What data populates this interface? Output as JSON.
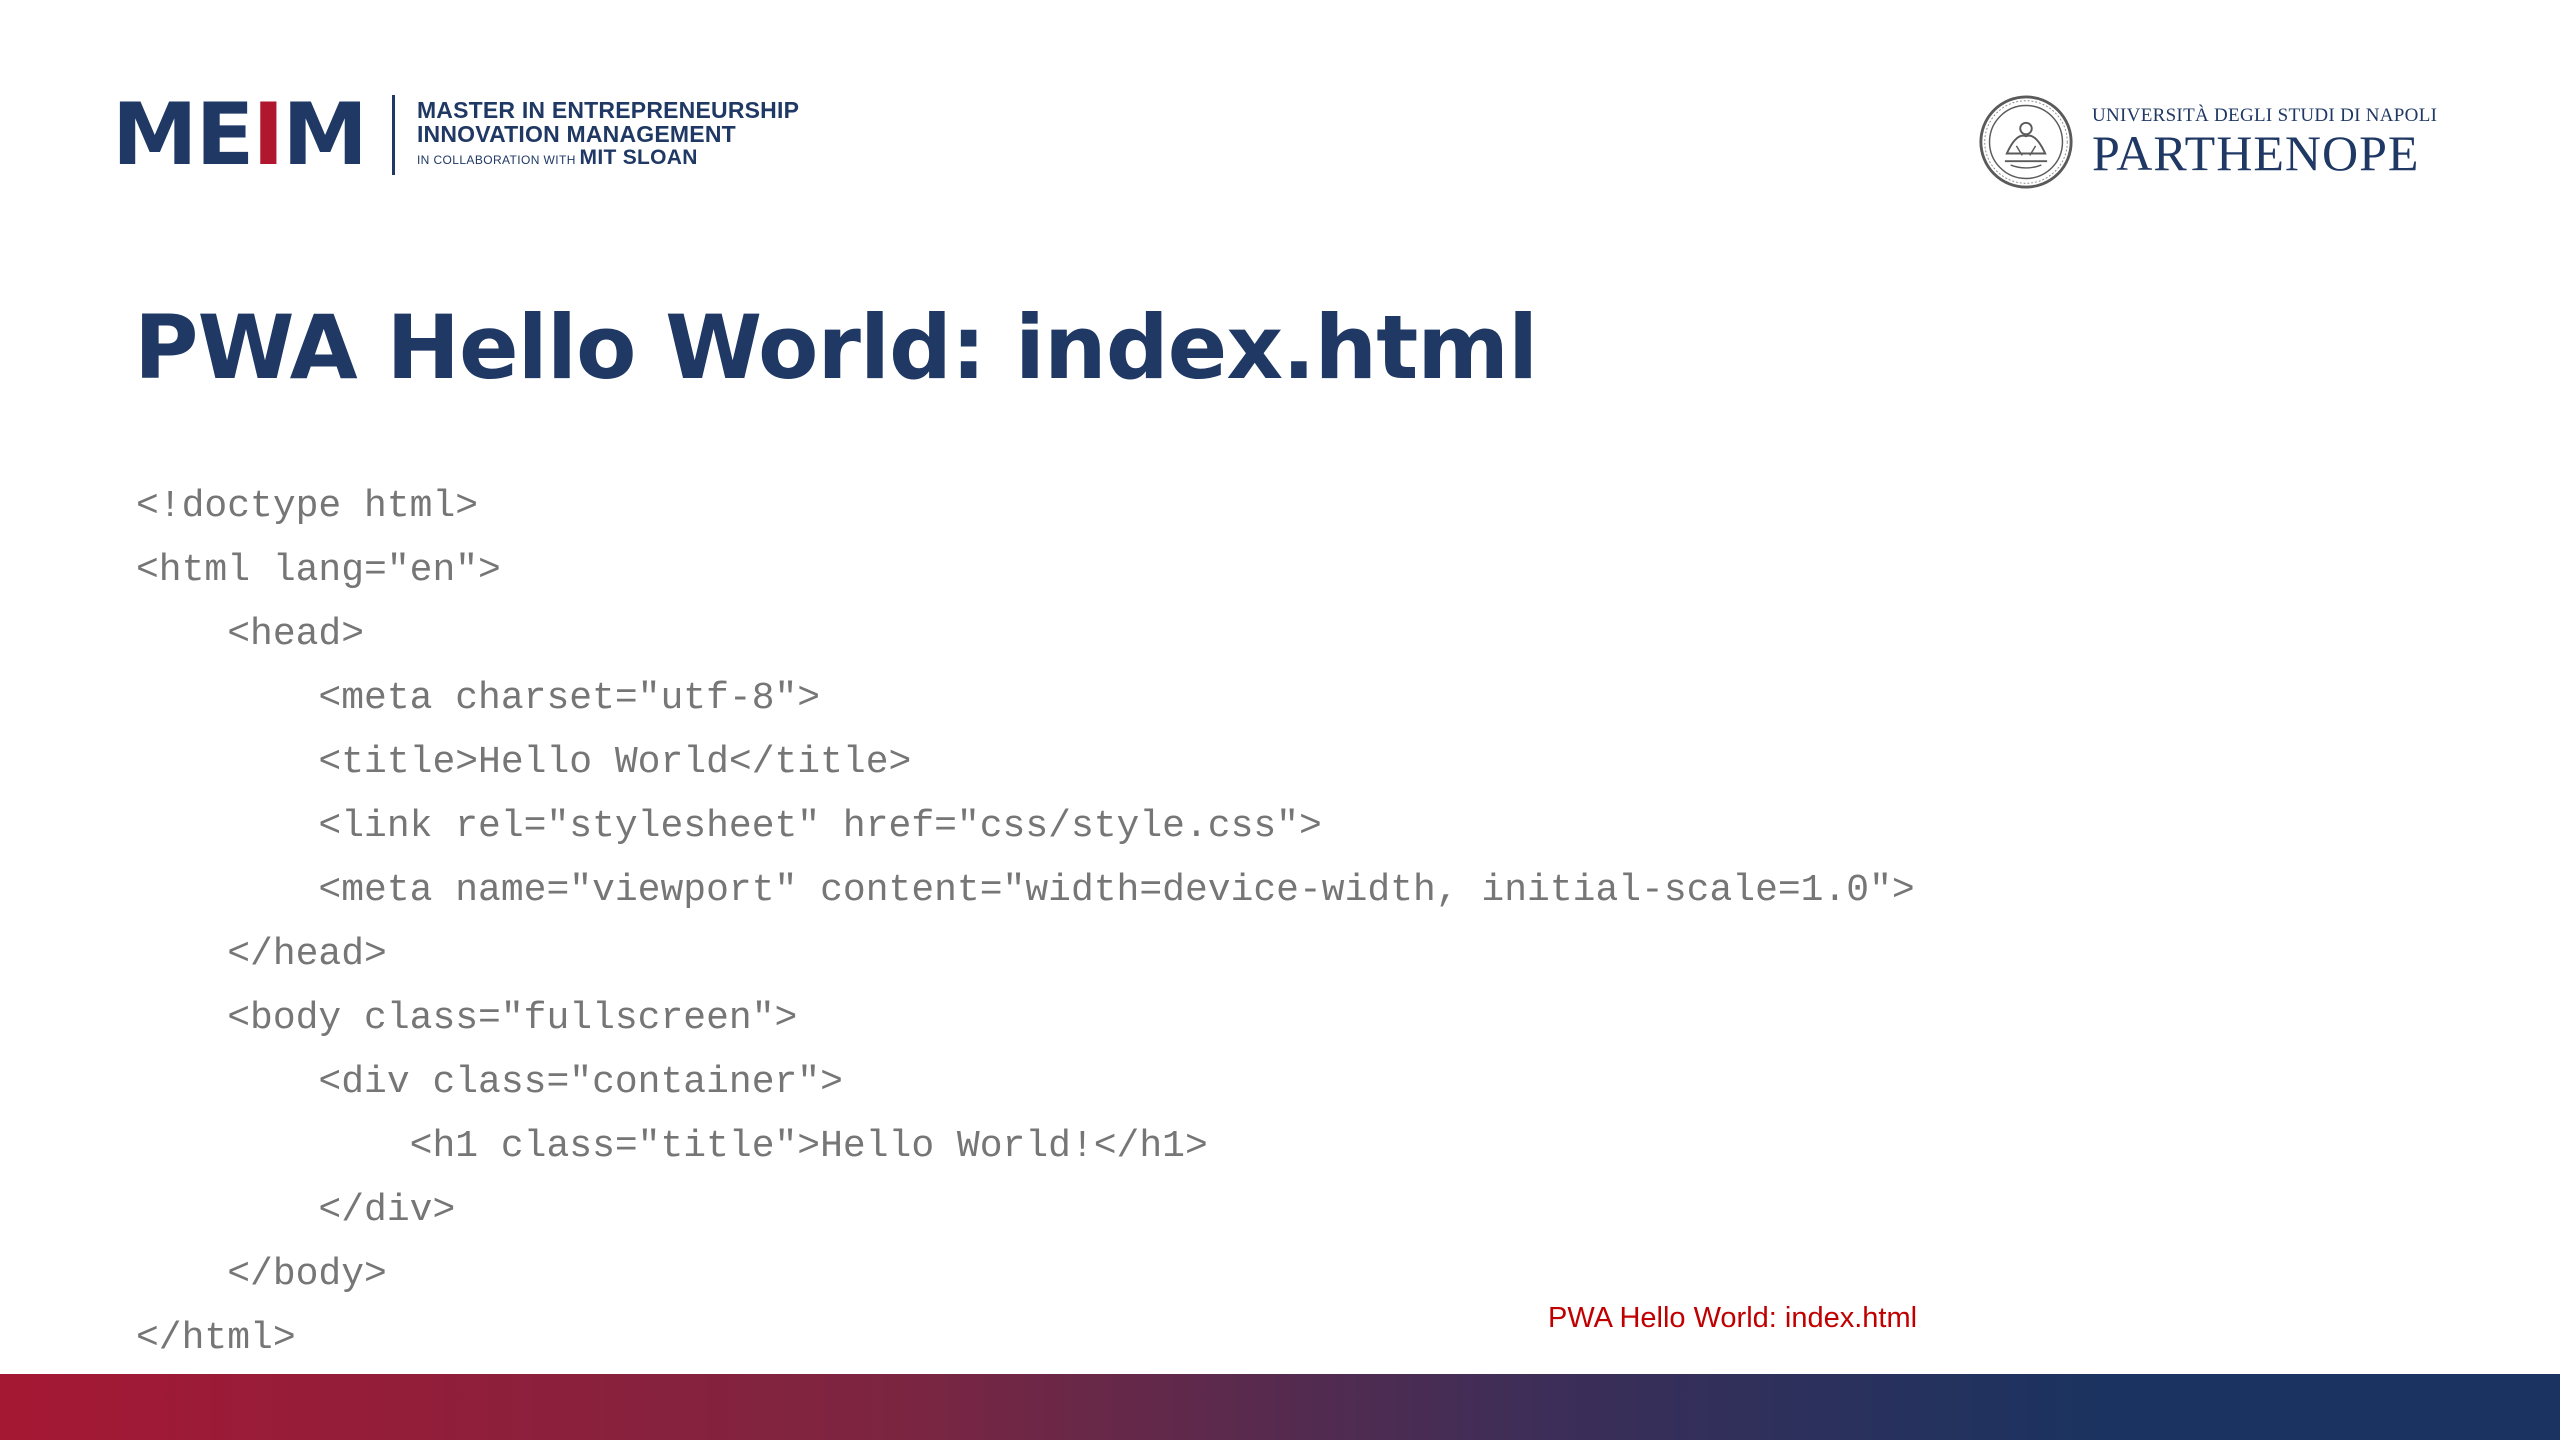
{
  "header": {
    "meim_logo": {
      "mark_m": "M",
      "mark_e": "E",
      "mark_i": "I",
      "mark_m2": "M",
      "line1": "MASTER IN ENTREPRENEURSHIP",
      "line2": "INNOVATION MANAGEMENT",
      "line3_prefix": "IN COLLABORATION WITH",
      "line3_emph": "MIT SLOAN",
      "brand_color": "#1f3864",
      "accent_color": "#b0172e"
    },
    "university_logo": {
      "university_line": "UNIVERSITÀ DEGLI STUDI DI NAPOLI",
      "name": "PARTHENOPE",
      "seal_icon": "university-seal-icon"
    }
  },
  "slide": {
    "title": "PWA Hello World: index.html",
    "code_lines": [
      "<!doctype html>",
      "<html lang=\"en\">",
      "    <head>",
      "        <meta charset=\"utf-8\">",
      "        <title>Hello World</title>",
      "        <link rel=\"stylesheet\" href=\"css/style.css\">",
      "        <meta name=\"viewport\" content=\"width=device-width, initial-scale=1.0\">",
      "    </head>",
      "    <body class=\"fullscreen\">",
      "        <div class=\"container\">",
      "            <h1 class=\"title\">Hello World!</h1>",
      "        </div>",
      "    </body>",
      "</html>"
    ]
  },
  "footer": {
    "label": "PWA Hello World: index.html",
    "label_color": "#c00000",
    "bar_colors": [
      "#a51834",
      "#1b3360"
    ]
  }
}
